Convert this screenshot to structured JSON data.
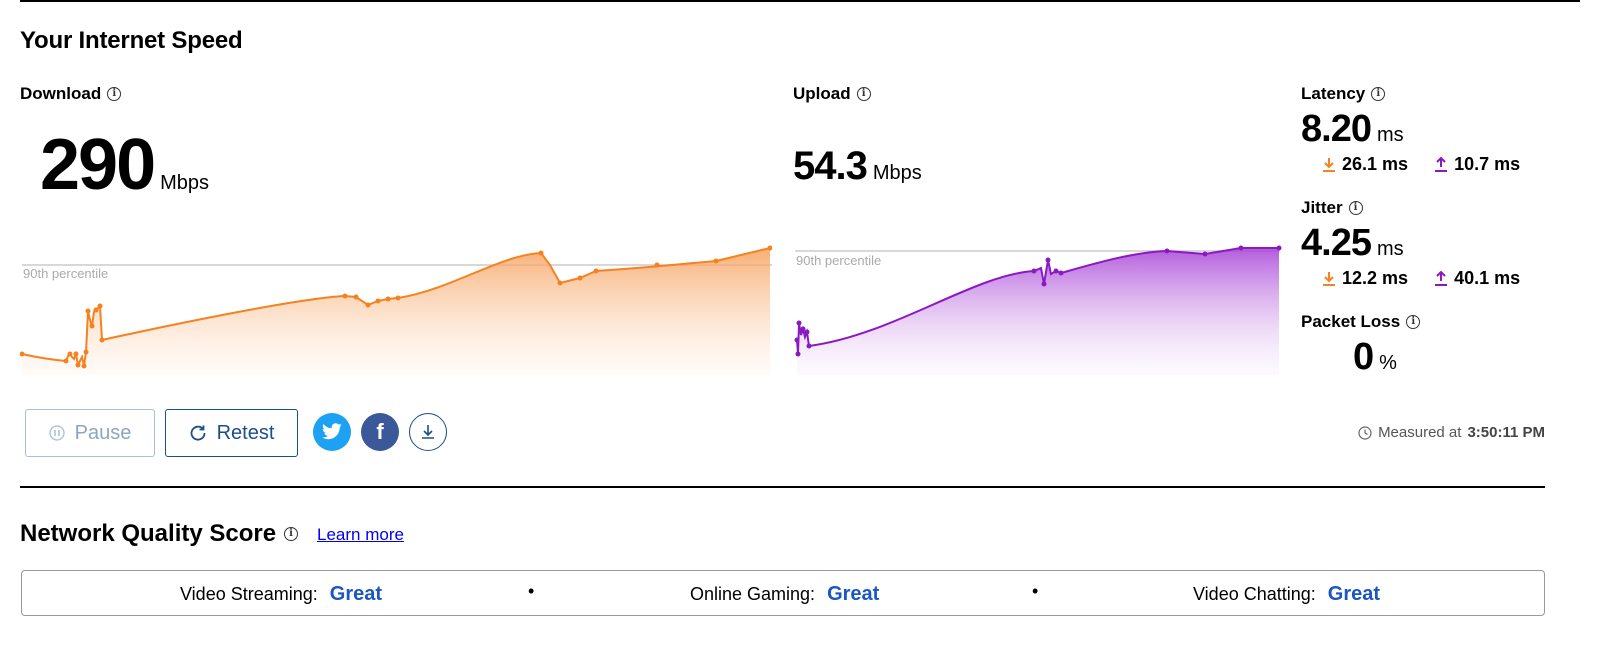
{
  "page": {
    "title": "Your Internet Speed"
  },
  "download": {
    "label": "Download",
    "value": "290",
    "unit": "Mbps",
    "percentile_label": "90th percentile",
    "color": "#f5821f"
  },
  "upload": {
    "label": "Upload",
    "value": "54.3",
    "unit": "Mbps",
    "percentile_label": "90th percentile",
    "color": "#8a19c2"
  },
  "latency": {
    "label": "Latency",
    "value": "8.20",
    "unit": "ms",
    "down": "26.1 ms",
    "up": "10.7 ms"
  },
  "jitter": {
    "label": "Jitter",
    "value": "4.25",
    "unit": "ms",
    "down": "12.2 ms",
    "up": "40.1 ms"
  },
  "packet_loss": {
    "label": "Packet Loss",
    "value": "0",
    "unit": "%"
  },
  "actions": {
    "pause_label": "Pause",
    "retest_label": "Retest",
    "twitter_icon": "twitter-icon",
    "facebook_icon": "facebook-icon",
    "download_icon": "download-icon"
  },
  "measured": {
    "prefix": "Measured at",
    "time": "3:50:11 PM"
  },
  "network_quality": {
    "title": "Network Quality Score",
    "learn_more": "Learn more",
    "items": [
      {
        "label": "Video Streaming:",
        "value": "Great"
      },
      {
        "label": "Online Gaming:",
        "value": "Great"
      },
      {
        "label": "Video Chatting:",
        "value": "Great"
      }
    ]
  }
}
